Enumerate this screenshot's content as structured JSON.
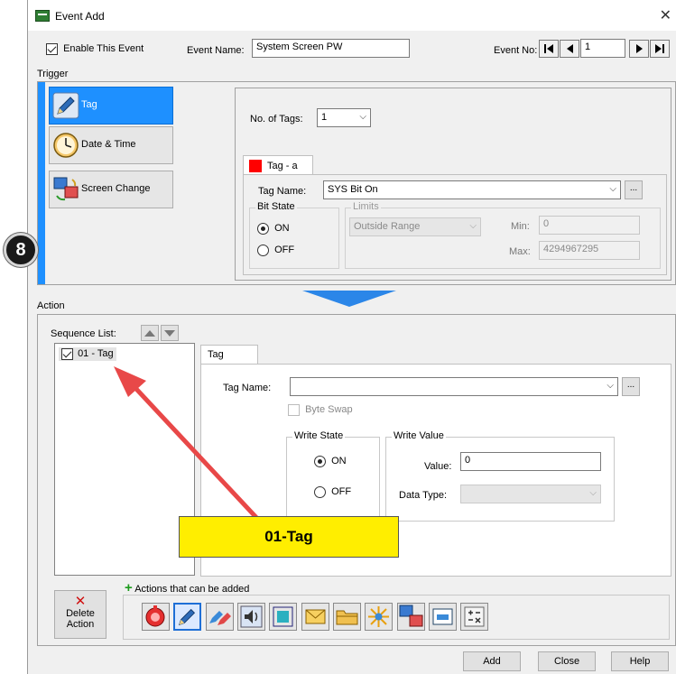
{
  "window": {
    "title": "Event Add"
  },
  "header": {
    "enable_label": "Enable This Event",
    "event_name_label": "Event Name:",
    "event_name_value": "System Screen PW",
    "event_no_label": "Event No:",
    "event_no_value": "1"
  },
  "trigger": {
    "section_label": "Trigger",
    "buttons": [
      {
        "label": "Tag"
      },
      {
        "label": "Date & Time"
      },
      {
        "label": "Screen Change"
      }
    ],
    "no_of_tags_label": "No. of Tags:",
    "no_of_tags_value": "1",
    "tab_label": "Tag - a",
    "tag_name_label": "Tag Name:",
    "tag_name_value": "SYS Bit On",
    "browse_label": "...",
    "bit_state": {
      "label": "Bit State",
      "on": "ON",
      "off": "OFF"
    },
    "limits": {
      "label": "Limits",
      "mode": "Outside Range",
      "min_label": "Min:",
      "min_value": "0",
      "max_label": "Max:",
      "max_value": "4294967295"
    }
  },
  "badge": {
    "text": "8"
  },
  "action": {
    "section_label": "Action",
    "sequence_list_label": "Sequence List:",
    "sequence_items": [
      {
        "label": "01 - Tag"
      }
    ],
    "tab_label": "Tag",
    "tag_name_label": "Tag Name:",
    "tag_name_value": "",
    "browse_label": "...",
    "byte_swap_label": "Byte Swap",
    "write_state": {
      "label": "Write State",
      "on": "ON",
      "off": "OFF"
    },
    "write_value": {
      "label": "Write Value",
      "value_label": "Value:",
      "value": "0",
      "data_type_label": "Data Type:",
      "data_type_value": ""
    },
    "actions_can_add_label": "Actions that can be added",
    "delete_action_label_1": "Delete",
    "delete_action_label_2": "Action"
  },
  "callout": {
    "text": "01-Tag"
  },
  "buttons": {
    "add": "Add",
    "close": "Close",
    "help": "Help"
  },
  "colors": {
    "accent": "#1e90ff",
    "callout_bg": "#ffee00",
    "arrow": "#e84848",
    "tag_swatch": "#ff0000"
  }
}
